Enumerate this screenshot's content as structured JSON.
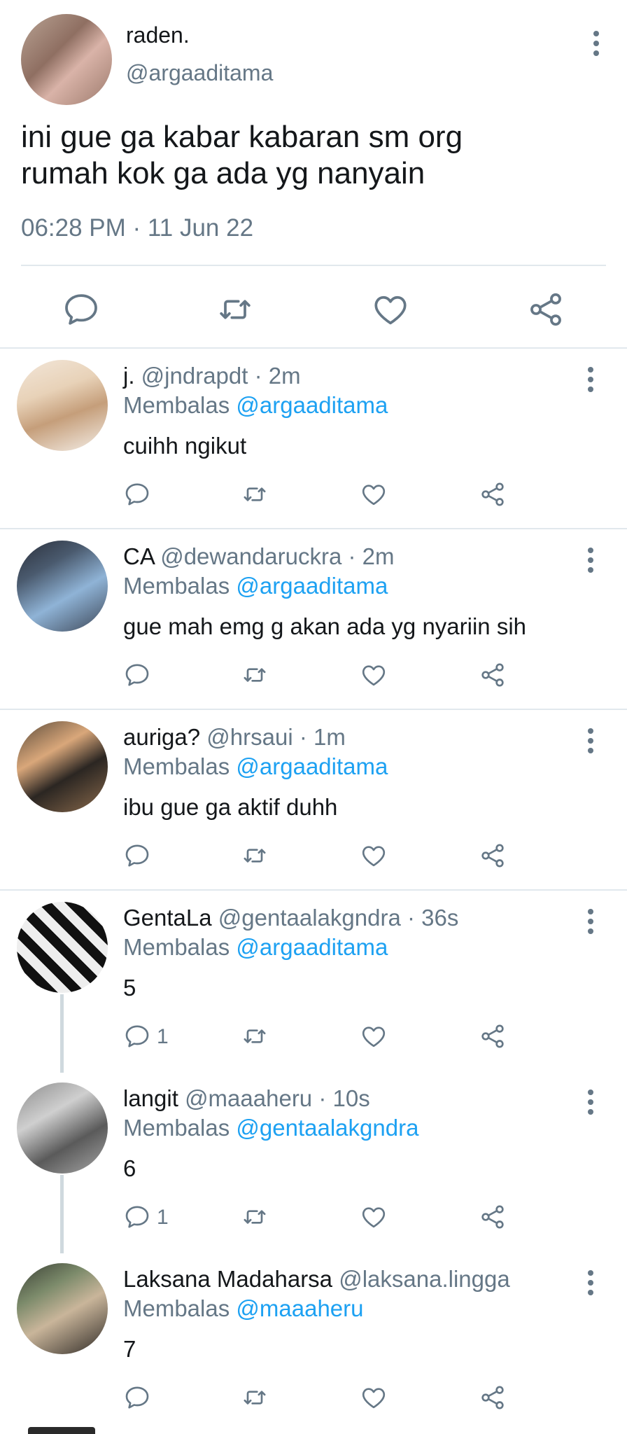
{
  "main_tweet": {
    "name": "raden.",
    "handle": "@argaaditama",
    "text": "ini gue ga kabar kabaran sm org\nrumah kok ga ada yg nanyain",
    "timestamp": "06:28 PM · 11 Jun 22",
    "actions": [
      "reply-icon",
      "retweet-icon",
      "like-icon",
      "share-icon"
    ]
  },
  "replies": [
    {
      "name": "j.",
      "handle": "@jndrapdt",
      "time": "· 2m",
      "replying_label": "Membalas",
      "mention": "@argaaditama",
      "text": "cuihh ngikut",
      "reply_count": ""
    },
    {
      "name": "CA",
      "handle": "@dewandaruckra",
      "time": "· 2m",
      "replying_label": "Membalas",
      "mention": "@argaaditama",
      "text": "gue mah emg g akan ada yg nyariin sih",
      "reply_count": ""
    },
    {
      "name": "auriga?",
      "handle": "@hrsaui",
      "time": "· 1m",
      "replying_label": "Membalas",
      "mention": "@argaaditama",
      "text": "ibu gue ga aktif duhh",
      "reply_count": ""
    },
    {
      "name": "GentaLa",
      "handle": "@gentaalakgndra",
      "time": "· 36s",
      "replying_label": "Membalas",
      "mention": "@argaaditama",
      "text": "5",
      "reply_count": "1"
    },
    {
      "name": "langit",
      "handle": "@maaaheru",
      "time": "· 10s",
      "replying_label": "Membalas",
      "mention": "@gentaalakgndra",
      "text": "6",
      "reply_count": "1"
    },
    {
      "name": "Laksana Madaharsa",
      "handle": "@laksana.lingga",
      "time": "",
      "replying_label": "Membalas",
      "mention": "@maaaheru",
      "text": "7",
      "reply_count": ""
    }
  ],
  "colors": {
    "accent": "#1da1f2",
    "muted": "#657786",
    "text": "#14171a",
    "divider": "#e1e8ed"
  }
}
